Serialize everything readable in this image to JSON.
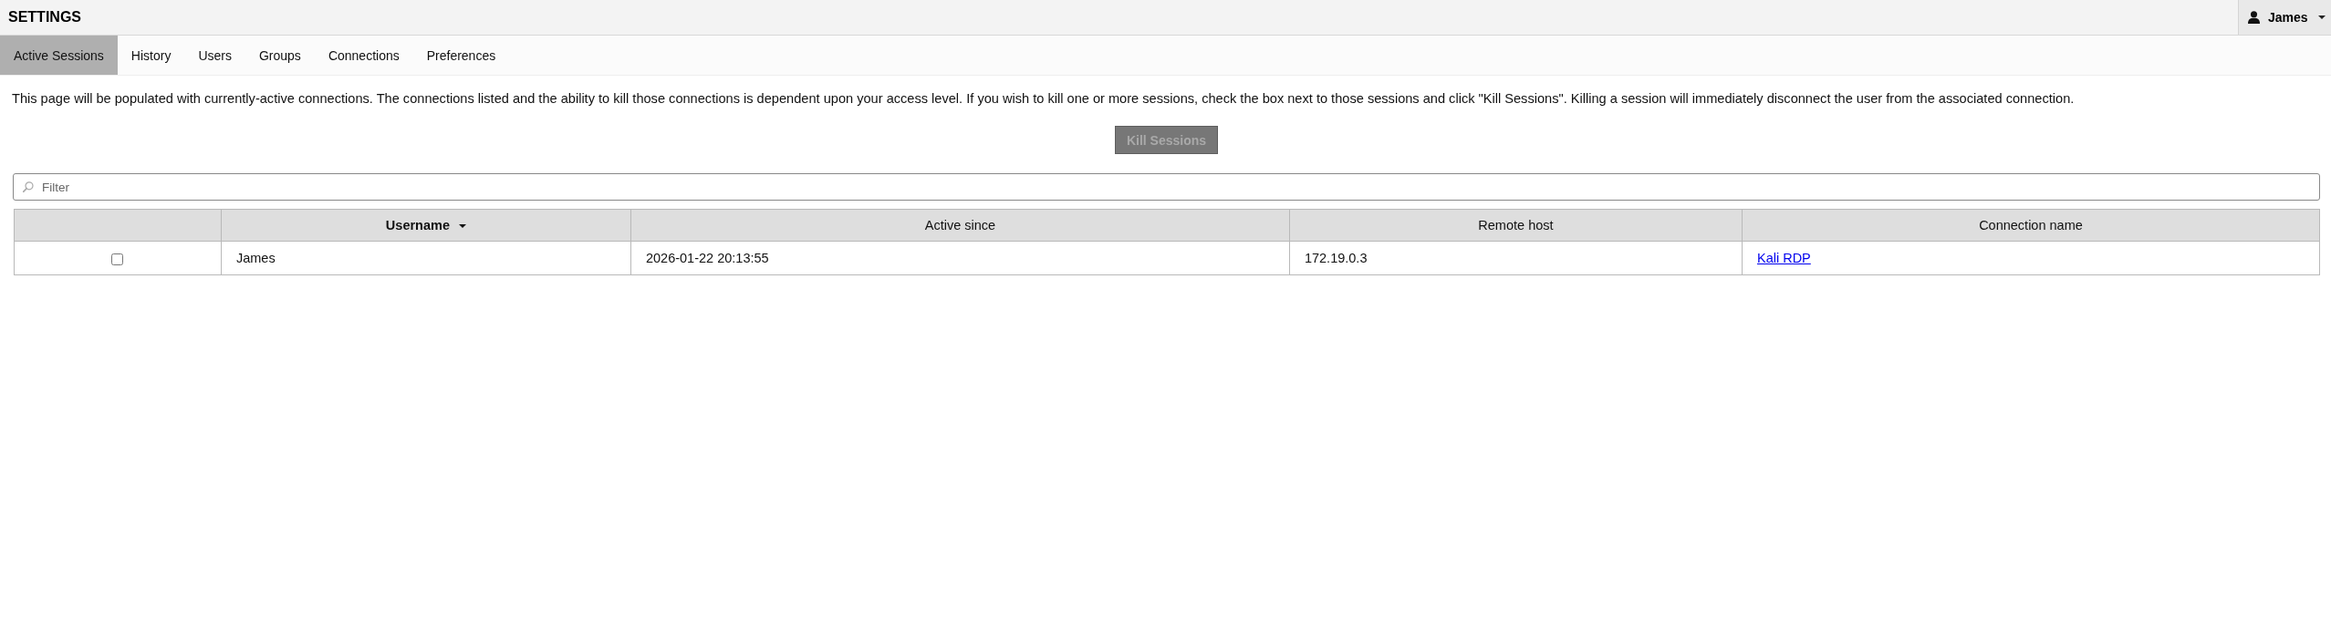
{
  "header": {
    "title": "SETTINGS",
    "user_menu": {
      "username": "James"
    }
  },
  "tabs": [
    {
      "label": "Active Sessions",
      "selected": true
    },
    {
      "label": "History",
      "selected": false
    },
    {
      "label": "Users",
      "selected": false
    },
    {
      "label": "Groups",
      "selected": false
    },
    {
      "label": "Connections",
      "selected": false
    },
    {
      "label": "Preferences",
      "selected": false
    }
  ],
  "description": "This page will be populated with currently-active connections. The connections listed and the ability to kill those connections is dependent upon your access level. If you wish to kill one or more sessions, check the box next to those sessions and click \"Kill Sessions\". Killing a session will immediately disconnect the user from the associated connection.",
  "kill_button": {
    "label": "Kill Sessions",
    "disabled": true
  },
  "filter": {
    "placeholder": "Filter"
  },
  "table": {
    "columns": [
      {
        "kind": "select"
      },
      {
        "kind": "text",
        "label": "Username",
        "sorted": true
      },
      {
        "kind": "text",
        "label": "Active since",
        "sorted": false
      },
      {
        "kind": "text",
        "label": "Remote host",
        "sorted": false
      },
      {
        "kind": "text",
        "label": "Connection name",
        "sorted": false
      }
    ],
    "rows": [
      {
        "cells": [
          {
            "kind": "checkbox",
            "checked": false
          },
          {
            "kind": "text",
            "text": "James"
          },
          {
            "kind": "text",
            "text": "2026-01-22 20:13:55"
          },
          {
            "kind": "text",
            "text": "172.19.0.3"
          },
          {
            "kind": "link",
            "text": "Kali RDP"
          }
        ]
      }
    ]
  }
}
